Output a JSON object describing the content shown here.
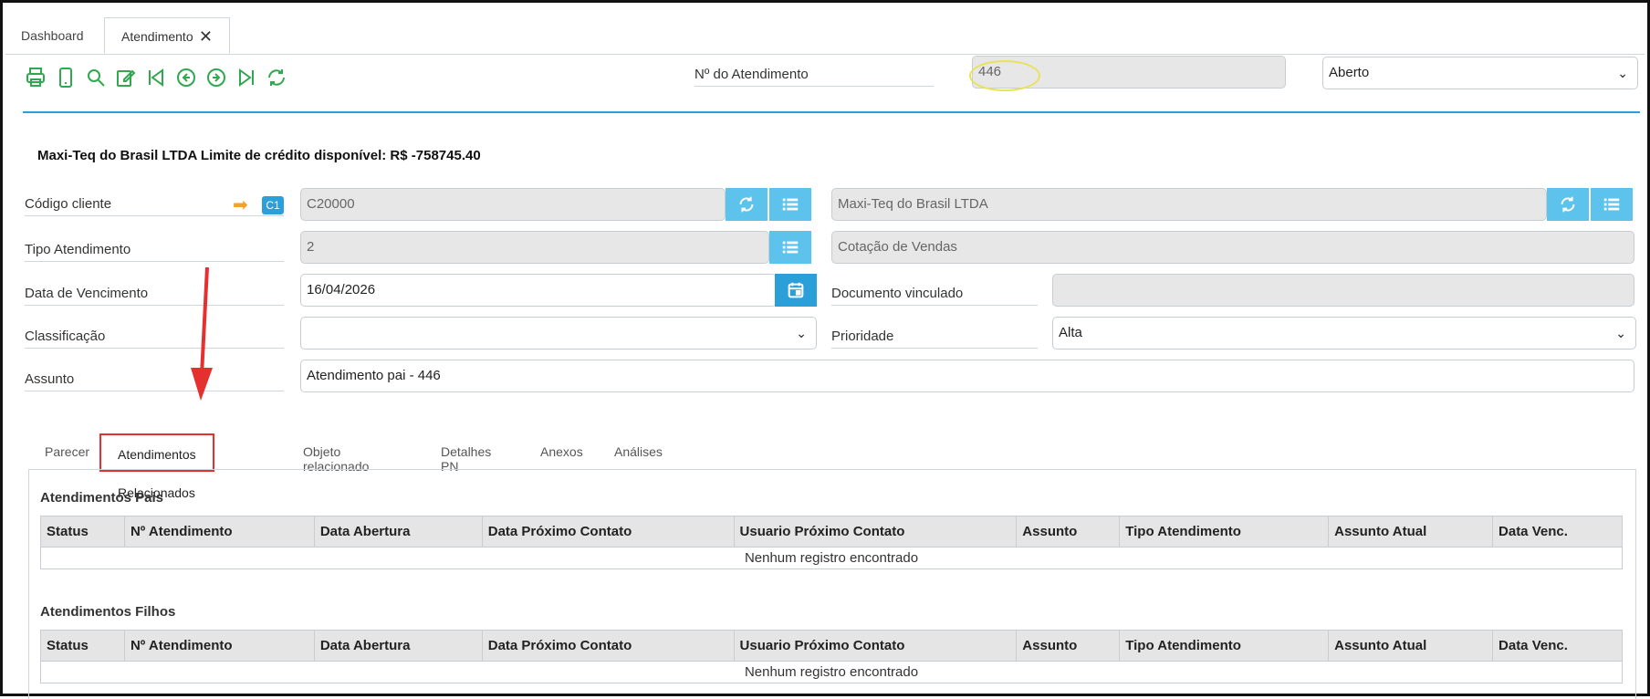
{
  "tabs": [
    {
      "label": "Dashboard"
    },
    {
      "label": "Atendimento",
      "close": "✕"
    }
  ],
  "toolbar": {
    "icons": [
      "print-icon",
      "mobile-icon",
      "search-icon",
      "edit-icon",
      "first-icon",
      "prev-icon",
      "next-icon",
      "last-icon",
      "refresh-icon"
    ],
    "accent": "#2fa84f"
  },
  "header": {
    "numero_label": "Nº do Atendimento",
    "numero_value": "446",
    "status_value": "Aberto"
  },
  "headline": "Maxi-Teq do Brasil LTDA Limite de crédito disponível: R$ -758745.40",
  "form": {
    "codigo_cliente_label": "Código cliente",
    "codigo_cliente_badge": "C1",
    "codigo_cliente_value": "C20000",
    "cliente_nome_value": "Maxi-Teq do Brasil LTDA",
    "tipo_atendimento_label": "Tipo Atendimento",
    "tipo_atendimento_value": "2",
    "tipo_atendimento_desc": "Cotação de Vendas",
    "data_vencimento_label": "Data de Vencimento",
    "data_vencimento_value": "16/04/2026",
    "documento_vinculado_label": "Documento vinculado",
    "documento_vinculado_value": "",
    "classificacao_label": "Classificação",
    "classificacao_value": "",
    "prioridade_label": "Prioridade",
    "prioridade_value": "Alta",
    "assunto_label": "Assunto",
    "assunto_value": "Atendimento pai - 446"
  },
  "sub_tabs": [
    "Parecer",
    "Atendimentos Relacionados",
    "Objeto relacionado",
    "Detalhes PN",
    "Anexos",
    "Análises"
  ],
  "tables": {
    "columns": [
      "Status",
      "Nº Atendimento",
      "Data Abertura",
      "Data Próximo Contato",
      "Usuario Próximo Contato",
      "Assunto",
      "Tipo Atendimento",
      "Assunto Atual",
      "Data Venc."
    ],
    "pais_title": "Atendimentos Pais",
    "filhos_title": "Atendimentos Filhos",
    "empty_message": "Nenhum registro encontrado"
  },
  "colors": {
    "primary": "#2a9fd8",
    "light_button": "#5ec3ec",
    "annotation_red": "#e53030",
    "annotation_yellow": "#e8e356"
  }
}
